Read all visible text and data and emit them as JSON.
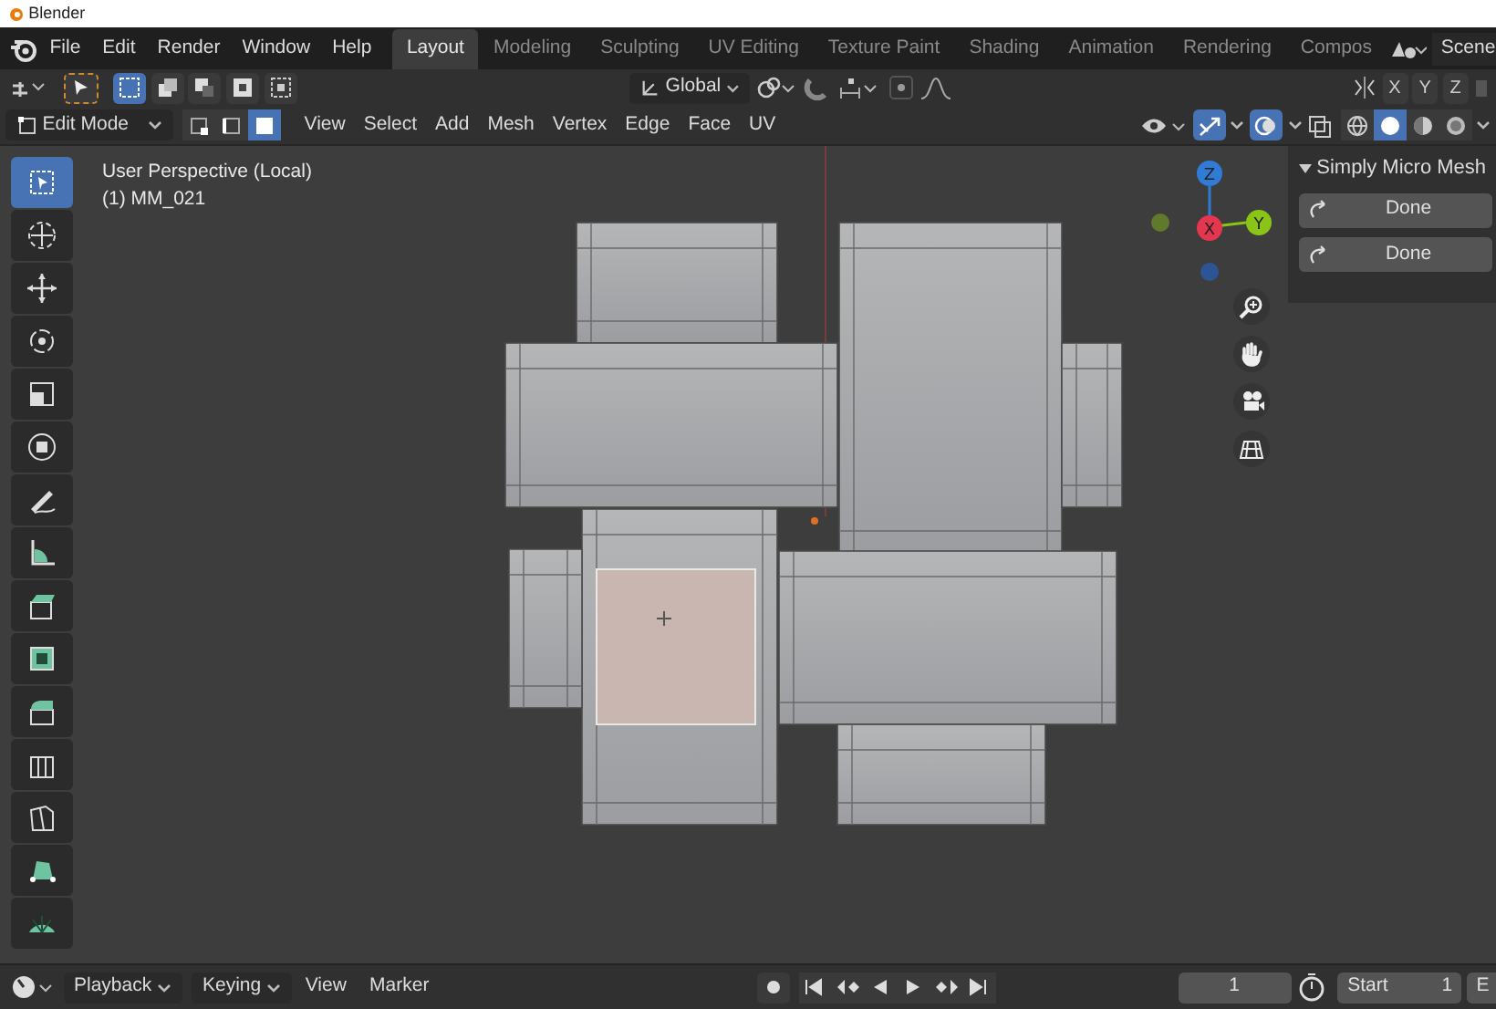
{
  "title_bar": {
    "title": "Blender"
  },
  "menu": [
    "File",
    "Edit",
    "Render",
    "Window",
    "Help"
  ],
  "workspace_tabs": [
    {
      "label": "Layout",
      "selected": true
    },
    {
      "label": "Modeling",
      "selected": false
    },
    {
      "label": "Sculpting",
      "selected": false
    },
    {
      "label": "UV Editing",
      "selected": false
    },
    {
      "label": "Texture Paint",
      "selected": false
    },
    {
      "label": "Shading",
      "selected": false
    },
    {
      "label": "Animation",
      "selected": false
    },
    {
      "label": "Rendering",
      "selected": false
    },
    {
      "label": "Compos",
      "selected": false
    }
  ],
  "scene": {
    "label": "Scene"
  },
  "tool_header": {
    "box_select_modes": [
      {
        "selected": true
      },
      {
        "selected": false
      },
      {
        "selected": false
      },
      {
        "selected": false
      },
      {
        "selected": false
      }
    ],
    "transform_orientation": "Global",
    "axes": [
      "X",
      "Y",
      "Z"
    ]
  },
  "editor_header": {
    "mode": "Edit Mode",
    "select_modes": [
      {
        "selected": false
      },
      {
        "selected": false
      },
      {
        "selected": true
      }
    ],
    "menus": [
      "View",
      "Select",
      "Add",
      "Mesh",
      "Vertex",
      "Edge",
      "Face",
      "UV"
    ],
    "gizmos_on": true,
    "overlays_on": true,
    "shading_modes": [
      {
        "selected": false
      },
      {
        "selected": true
      },
      {
        "selected": false
      },
      {
        "selected": false
      }
    ]
  },
  "viewport": {
    "overlay_lines": [
      "User Perspective (Local)",
      "(1) MM_021"
    ],
    "toolbar": [
      {
        "selected": true
      },
      {
        "selected": false
      },
      {
        "selected": false
      },
      {
        "selected": false
      },
      {
        "selected": false
      },
      {
        "selected": false
      },
      {
        "selected": false
      },
      {
        "selected": false
      },
      {
        "selected": false
      },
      {
        "selected": false
      },
      {
        "selected": false
      },
      {
        "selected": false
      },
      {
        "selected": false
      },
      {
        "selected": false
      },
      {
        "selected": false
      }
    ],
    "gizmo_axes": [
      "Z",
      "X",
      "Y"
    ]
  },
  "sidebar": {
    "panel_title": "Simply Micro Mesh",
    "expanded": true,
    "buttons": [
      "Done",
      "Done"
    ]
  },
  "timeline": {
    "menus": [
      "Playback",
      "Keying",
      "View",
      "Marker"
    ],
    "current_frame": "1",
    "start_label": "Start",
    "start_value": "1",
    "end_label": "E"
  }
}
